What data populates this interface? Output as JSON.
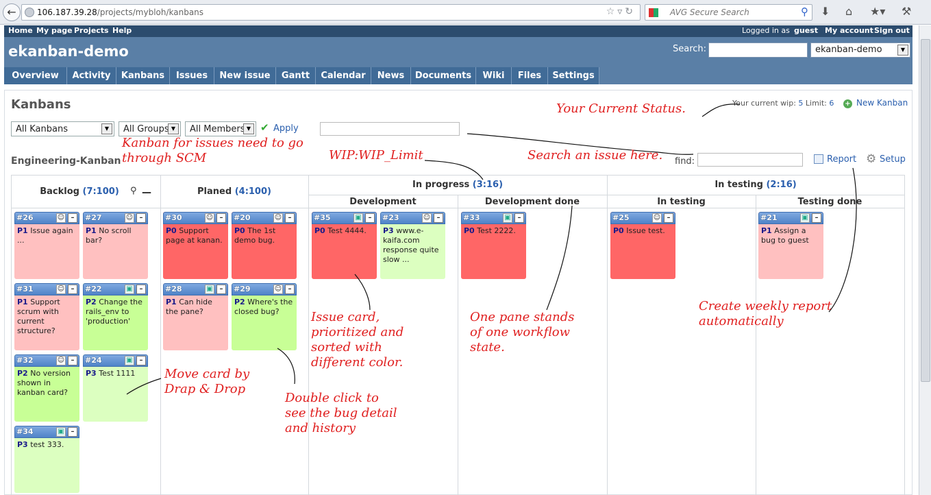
{
  "browser": {
    "url_host": "106.187.39.28",
    "url_path": "/projects/mybloh/kanbans",
    "search_placeholder": "AVG Secure Search"
  },
  "topmenu": {
    "home": "Home",
    "mypage": "My page",
    "projects": "Projects",
    "help": "Help",
    "logged_in_prefix": "Logged in as",
    "user": "guest",
    "my_account": "My account",
    "sign_out": "Sign out"
  },
  "header": {
    "title": "ekanban-demo",
    "search_label": "Search:",
    "project_select": "ekanban-demo"
  },
  "tabs": [
    "Overview",
    "Activity",
    "Kanbans",
    "Issues",
    "New issue",
    "Gantt",
    "Calendar",
    "News",
    "Documents",
    "Wiki",
    "Files",
    "Settings"
  ],
  "page": {
    "heading": "Kanbans",
    "wip_label": "Your current wip:",
    "wip_value": "5",
    "limit_label": "Limit:",
    "limit_value": "6",
    "new_kanban": "New Kanban",
    "filters": [
      "All Kanbans",
      "All Groups",
      "All Members"
    ],
    "apply": "Apply",
    "kanban_name": "Engineering-Kanban",
    "find_label": "find:",
    "report": "Report",
    "setup": "Setup"
  },
  "board": {
    "backlog": {
      "name": "Backlog",
      "count": "(7:100)"
    },
    "planed": {
      "name": "Planed",
      "count": "(4:100)"
    },
    "in_progress": {
      "name": "In progress",
      "count": "(3:16)"
    },
    "in_testing": {
      "name": "In testing",
      "count": "(2:16)"
    },
    "sub_development": "Development",
    "sub_development_done": "Development done",
    "sub_in_testing": "In testing",
    "sub_testing_done": "Testing done"
  },
  "cards": [
    {
      "id": "#26",
      "priority": "P1",
      "text": "Issue again ...",
      "color": "#ffc0c0",
      "avatar": "person-icon"
    },
    {
      "id": "#27",
      "priority": "P1",
      "text": "No scroll bar?",
      "color": "#ffc0c0",
      "avatar": "person-icon"
    },
    {
      "id": "#31",
      "priority": "P1",
      "text": "Support scrum with current structure?",
      "color": "#ffc0c0",
      "avatar": "person-icon"
    },
    {
      "id": "#22",
      "priority": "P2",
      "text": "Change the rails_env to 'production'",
      "color": "#c8ff96",
      "avatar": "robot-icon"
    },
    {
      "id": "#32",
      "priority": "P2",
      "text": "No version shown in kanban card?",
      "color": "#c8ff96",
      "avatar": "person-icon"
    },
    {
      "id": "#24",
      "priority": "P3",
      "text": "Test 1111",
      "color": "#dcffc0",
      "avatar": "robot-icon"
    },
    {
      "id": "#34",
      "priority": "P3",
      "text": "test 333.",
      "color": "#dcffc0",
      "avatar": "robot-icon"
    },
    {
      "id": "#30",
      "priority": "P0",
      "text": "Support page at kanan.",
      "color": "#ff6666",
      "avatar": "person-icon"
    },
    {
      "id": "#20",
      "priority": "P0",
      "text": "The 1st demo bug.",
      "color": "#ff6666",
      "avatar": "person-icon"
    },
    {
      "id": "#28",
      "priority": "P1",
      "text": "Can hide the pane?",
      "color": "#ffc0c0",
      "avatar": "robot-icon"
    },
    {
      "id": "#29",
      "priority": "P2",
      "text": "Where's the closed bug?",
      "color": "#c8ff96",
      "avatar": "person-icon"
    },
    {
      "id": "#35",
      "priority": "P0",
      "text": "Test 4444.",
      "color": "#ff6666",
      "avatar": "robot-icon"
    },
    {
      "id": "#23",
      "priority": "P3",
      "text": "www.e-kaifa.com response quite slow ...",
      "color": "#dcffc0",
      "avatar": "person-icon"
    },
    {
      "id": "#33",
      "priority": "P0",
      "text": "Test 2222.",
      "color": "#ff6666",
      "avatar": "robot-icon"
    },
    {
      "id": "#25",
      "priority": "P0",
      "text": "Issue test.",
      "color": "#ff6666",
      "avatar": "person-icon"
    },
    {
      "id": "#21",
      "priority": "P1",
      "text": "Assign a bug to guest",
      "color": "#ffc0c0",
      "avatar": "robot-icon"
    }
  ],
  "annotations": {
    "current_status": "Your Current Status.",
    "kanban_scm_1": "Kanban for issues need to go",
    "kanban_scm_2": "through SCM",
    "wip_limit": "WIP:WIP_Limit",
    "search_issue": "Search an issue here.",
    "issue_card_1": "Issue card,",
    "issue_card_2": "prioritized and",
    "issue_card_3": "sorted with",
    "issue_card_4": "different color.",
    "pane_1": "One pane stands",
    "pane_2": "of one workflow",
    "pane_3": "state.",
    "report_1": "Create weekly report",
    "report_2": "automatically",
    "move_1": "Move card by",
    "move_2": "Drap & Drop",
    "dblclick_1": "Double click to",
    "dblclick_2": "see the bug detail",
    "dblclick_3": "and history"
  },
  "colors": {
    "header": "#5a7fa6",
    "topmenu": "#2c4c6e",
    "tab": "#406b97",
    "annotation": "#e02020",
    "link": "#2a5fae"
  }
}
